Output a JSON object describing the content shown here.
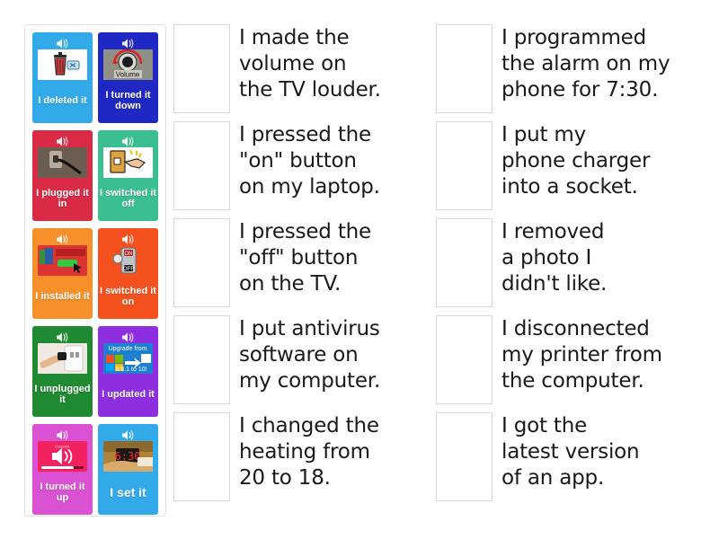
{
  "activity": {
    "type": "match-up",
    "title": "Technology verbs match-up"
  },
  "tile_panel": {
    "name": "draggable-tiles",
    "tiles": [
      {
        "label": "I deleted it",
        "color": "#32aaea",
        "icon": "speaker-icon",
        "picture": "recycle-bin-delete-icon",
        "label_size": "normal"
      },
      {
        "label": "I turned it down",
        "color": "#2028c4",
        "icon": "speaker-icon",
        "picture": "volume-knob-turned-down",
        "label_size": "normal"
      },
      {
        "label": "I plugged it in",
        "color": "#d92b45",
        "icon": "speaker-icon",
        "picture": "plug-into-wall-socket",
        "label_size": "normal"
      },
      {
        "label": "I switched it off",
        "color": "#3cbe93",
        "icon": "speaker-icon",
        "picture": "hand-flipping-light-switch-off",
        "label_size": "normal"
      },
      {
        "label": "I installed it",
        "color": "#f5902b",
        "icon": "speaker-icon",
        "picture": "software-install-click",
        "label_size": "normal"
      },
      {
        "label": "I switched it on",
        "color": "#f4511e",
        "icon": "speaker-icon",
        "picture": "on-off-toggle-switch",
        "label_size": "normal"
      },
      {
        "label": "I unplugged it",
        "color": "#1f8a32",
        "icon": "speaker-icon",
        "picture": "hand-unplugging-cable",
        "label_size": "normal"
      },
      {
        "label": "I updated it",
        "color": "#8d2ee0",
        "icon": "speaker-icon",
        "picture": "windows-upgrade-banner",
        "label_size": "normal"
      },
      {
        "label": "I turned it up",
        "color": "#da52d3",
        "icon": "speaker-icon",
        "picture": "volume-slider-up",
        "label_size": "normal"
      },
      {
        "label": "I set it",
        "color": "#32aaea",
        "icon": "speaker-icon",
        "picture": "hand-setting-alarm-clock",
        "label_size": "big"
      }
    ]
  },
  "columns": [
    {
      "name": "answers-column-left",
      "items": [
        {
          "text": "I made the\nvolume on\nthe TV louder."
        },
        {
          "text": "I pressed the\n\"on\" button\non my laptop."
        },
        {
          "text": "I pressed the\n\"off\" button\non the TV."
        },
        {
          "text": "I put antivirus\nsoftware on\nmy computer."
        },
        {
          "text": "I changed the\nheating from\n20 to 18."
        }
      ]
    },
    {
      "name": "answers-column-right",
      "items": [
        {
          "text": "I programmed\nthe alarm on my\nphone for 7:30."
        },
        {
          "text": "I put my\nphone charger\ninto a socket."
        },
        {
          "text": "I removed\na photo I\ndidn't like."
        },
        {
          "text": "I disconnected\nmy printer from\nthe computer."
        },
        {
          "text": "I got the\nlatest version\nof an app."
        }
      ]
    }
  ],
  "colors": {
    "page_background": "#ffffff",
    "panel_border": "#e2e2e2",
    "dropbox_border": "#d8d8d8",
    "text": "#1a1a1a"
  }
}
